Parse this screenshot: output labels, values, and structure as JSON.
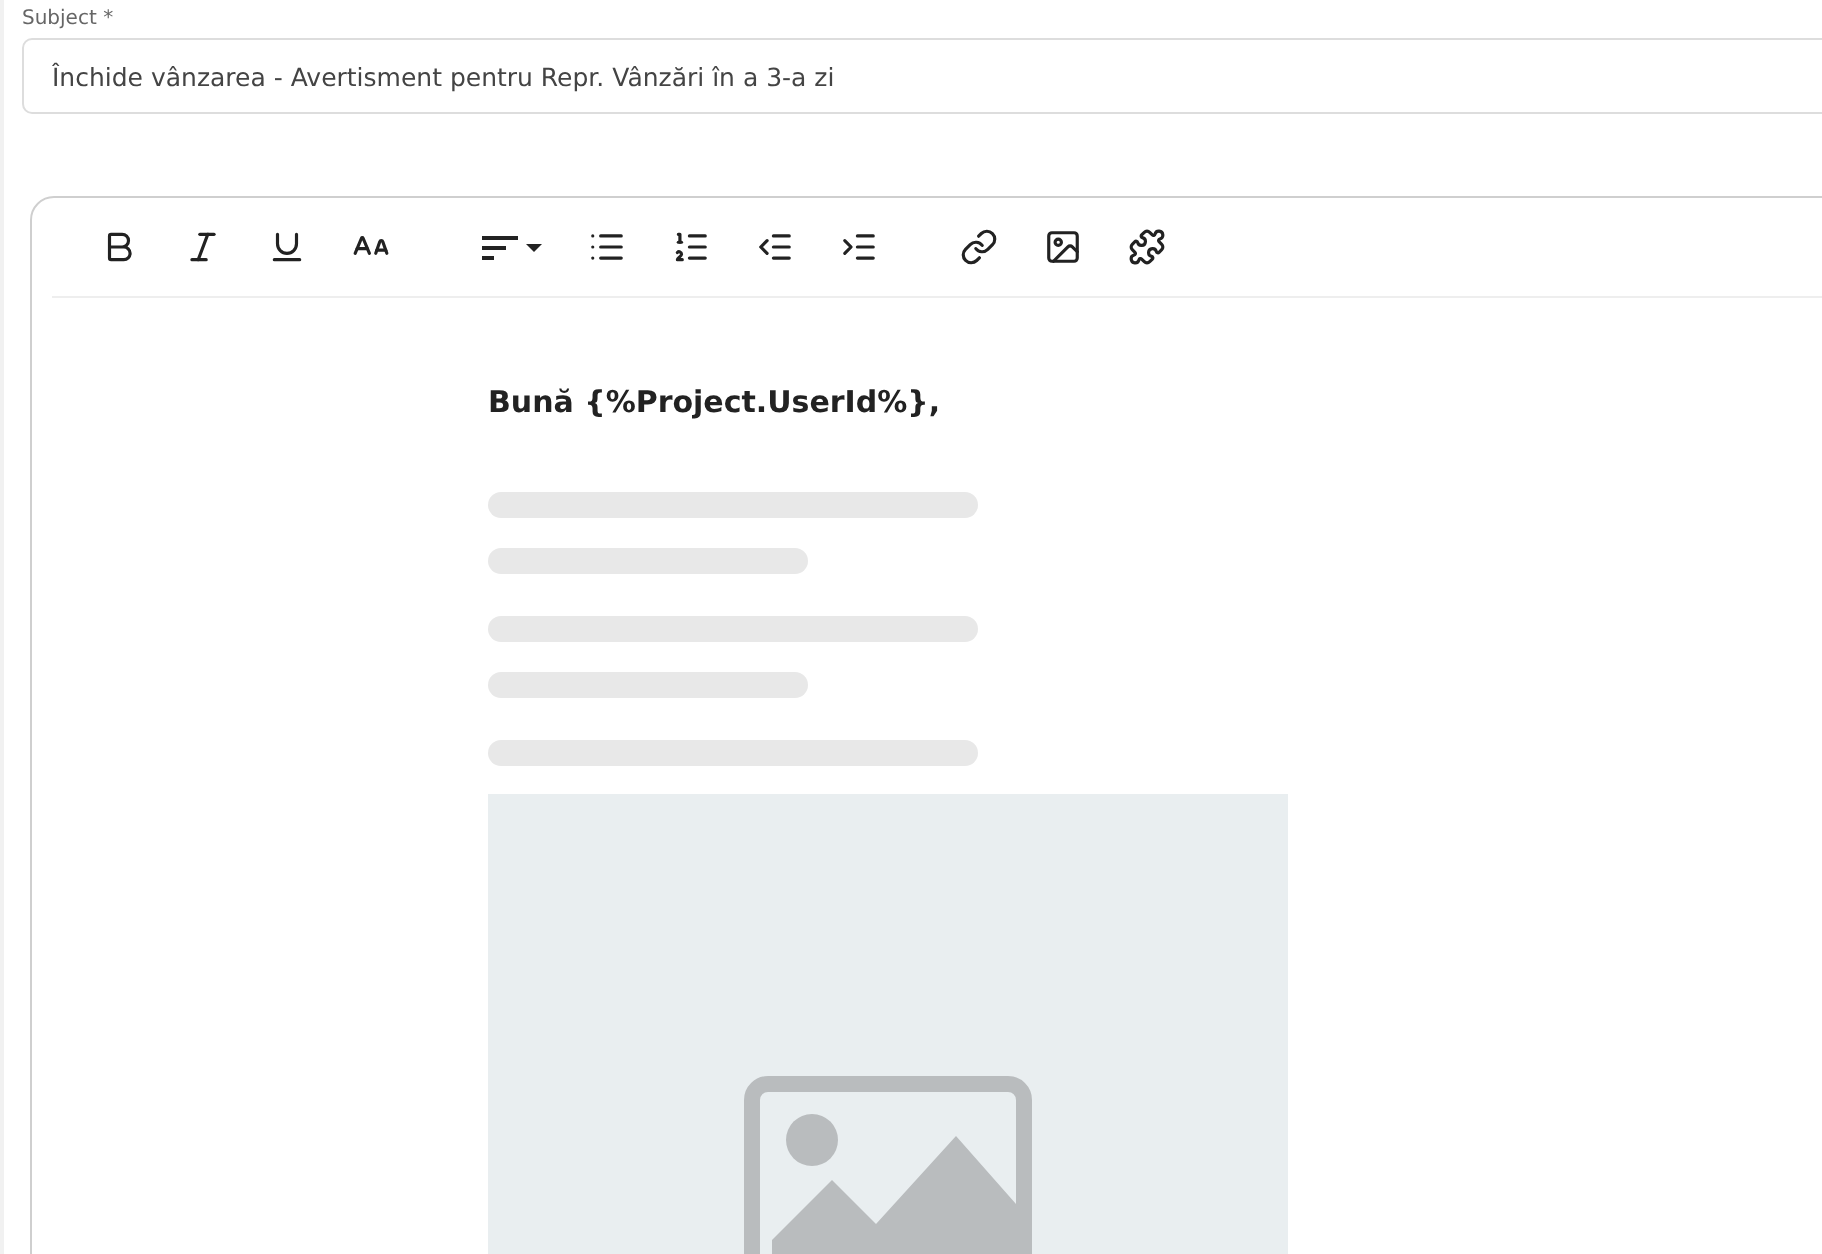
{
  "subject": {
    "label": "Subject",
    "required_mark": "*",
    "value": "Închide vânzarea - Avertisment pentru Repr. Vânzări în a 3-a zi"
  },
  "toolbar": [
    {
      "kind": "bold"
    },
    {
      "kind": "italic"
    },
    {
      "kind": "underline"
    },
    {
      "kind": "font-size"
    },
    {
      "kind": "align"
    },
    {
      "kind": "bullet-list"
    },
    {
      "kind": "numbered-list"
    },
    {
      "kind": "outdent"
    },
    {
      "kind": "indent"
    },
    {
      "kind": "link"
    },
    {
      "kind": "image"
    },
    {
      "kind": "plugin"
    }
  ],
  "editor": {
    "greeting": "Bună {%Project.UserId%},"
  }
}
